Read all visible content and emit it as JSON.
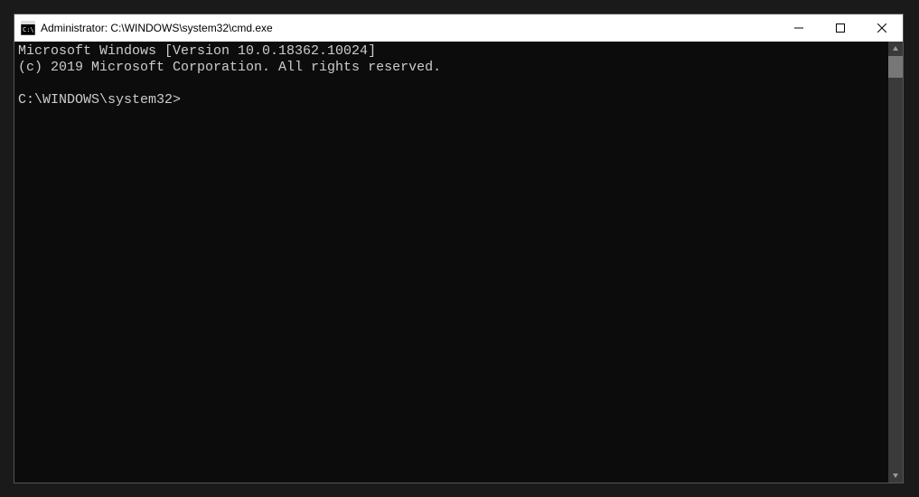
{
  "titlebar": {
    "title": "Administrator: C:\\WINDOWS\\system32\\cmd.exe"
  },
  "console": {
    "line1": "Microsoft Windows [Version 10.0.18362.10024]",
    "line2": "(c) 2019 Microsoft Corporation. All rights reserved.",
    "prompt": "C:\\WINDOWS\\system32>"
  },
  "colors": {
    "console_bg": "#0c0c0c",
    "console_fg": "#cccccc",
    "titlebar_bg": "#ffffff"
  }
}
